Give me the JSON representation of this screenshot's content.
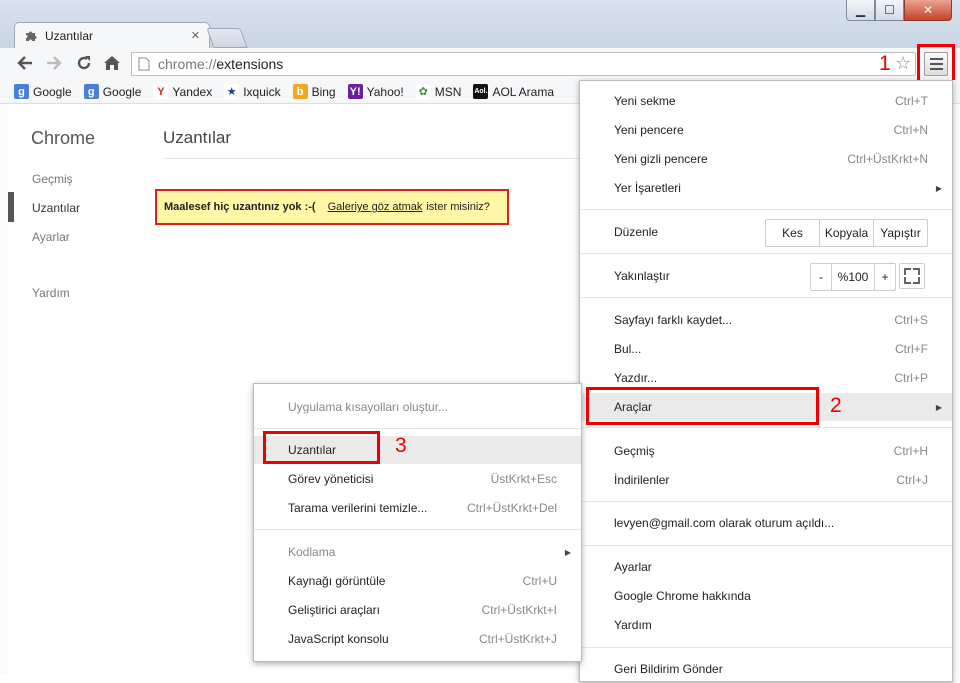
{
  "window": {
    "tab_title": "Uzantılar",
    "tab_icon": "puzzle-icon",
    "minimize": "▁",
    "maximize": "☐",
    "close": "✕",
    "tab_close": "✕"
  },
  "toolbar": {
    "url_scheme": "chrome://",
    "url_path": "extensions",
    "page_icon": "page-icon"
  },
  "bookmarks": [
    {
      "label": "Google",
      "icon": "google-icon",
      "color": "#4a7fd8",
      "glyph": "g"
    },
    {
      "label": "Google",
      "icon": "google-icon",
      "color": "#4a7fd8",
      "glyph": "g"
    },
    {
      "label": "Yandex",
      "icon": "yandex-icon",
      "color": "#ffffff",
      "glyph": "Y"
    },
    {
      "label": "Ixquick",
      "icon": "ixquick-star-icon",
      "color": "#ffffff",
      "glyph": "★"
    },
    {
      "label": "Bing",
      "icon": "bing-icon",
      "color": "#f5a623",
      "glyph": "b"
    },
    {
      "label": "Yahoo!",
      "icon": "yahoo-icon",
      "color": "#6b1fa0",
      "glyph": "Y!"
    },
    {
      "label": "MSN",
      "icon": "msn-butterfly-icon",
      "color": "#ffffff",
      "glyph": "✿"
    },
    {
      "label": "AOL Arama",
      "icon": "aol-icon",
      "color": "#111111",
      "glyph": "Aol."
    }
  ],
  "sidebar": {
    "heading": "Chrome",
    "items": [
      "Geçmiş",
      "Uzantılar",
      "Ayarlar",
      "Yardım"
    ]
  },
  "page": {
    "title": "Uzantılar",
    "notice_bold": "Maalesef hiç uzantınız yok :-(",
    "notice_link": "Galeriye göz atmak",
    "notice_rest": "ister misiniz?"
  },
  "main_menu": {
    "new_tab": {
      "label": "Yeni sekme",
      "shortcut": "Ctrl+T"
    },
    "new_window": {
      "label": "Yeni pencere",
      "shortcut": "Ctrl+N"
    },
    "incognito": {
      "label": "Yeni gizli pencere",
      "shortcut": "Ctrl+ÜstKrkt+N"
    },
    "bookmarks": {
      "label": "Yer İşaretleri"
    },
    "edit": {
      "label": "Düzenle",
      "cut": "Kes",
      "copy": "Kopyala",
      "paste": "Yapıştır"
    },
    "zoom": {
      "label": "Yakınlaştır",
      "minus": "-",
      "level": "%100",
      "plus": "+"
    },
    "save_as": {
      "label": "Sayfayı farklı kaydet...",
      "shortcut": "Ctrl+S"
    },
    "find": {
      "label": "Bul...",
      "shortcut": "Ctrl+F"
    },
    "print": {
      "label": "Yazdır...",
      "shortcut": "Ctrl+P"
    },
    "tools": {
      "label": "Araçlar"
    },
    "history": {
      "label": "Geçmiş",
      "shortcut": "Ctrl+H"
    },
    "downloads": {
      "label": "İndirilenler",
      "shortcut": "Ctrl+J"
    },
    "signed_in": {
      "label": "levyen@gmail.com olarak oturum açıldı..."
    },
    "settings": {
      "label": "Ayarlar"
    },
    "about": {
      "label": "Google Chrome hakkında"
    },
    "help": {
      "label": "Yardım"
    },
    "feedback": {
      "label": "Geri Bildirim Gönder"
    }
  },
  "tools_menu": {
    "create_shortcuts": {
      "label": "Uygulama kısayolları oluştur..."
    },
    "extensions": {
      "label": "Uzantılar"
    },
    "task_manager": {
      "label": "Görev yöneticisi",
      "shortcut": "ÜstKrkt+Esc"
    },
    "clear_data": {
      "label": "Tarama verilerini temizle...",
      "shortcut": "Ctrl+ÜstKrkt+Del"
    },
    "encoding": {
      "label": "Kodlama"
    },
    "view_source": {
      "label": "Kaynağı görüntüle",
      "shortcut": "Ctrl+U"
    },
    "dev_tools": {
      "label": "Geliştirici araçları",
      "shortcut": "Ctrl+ÜstKrkt+I"
    },
    "js_console": {
      "label": "JavaScript konsolu",
      "shortcut": "Ctrl+ÜstKrkt+J"
    }
  },
  "annotations": {
    "step1": "1",
    "step2": "2",
    "step3": "3",
    "color": "#e00000"
  }
}
